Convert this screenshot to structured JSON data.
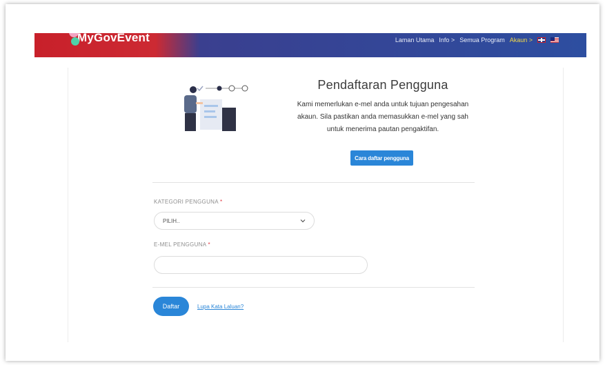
{
  "colors": {
    "primary": "#2a86d8",
    "nav_red": "#c8202a",
    "nav_blue": "#2d4ea0",
    "required": "#e0343f"
  },
  "navbar": {
    "logo": "MyGovEvent",
    "links": [
      {
        "label": "Laman Utama"
      },
      {
        "label": "Info >"
      },
      {
        "label": "Semua Program"
      },
      {
        "label": "Akaun >"
      }
    ],
    "flags": [
      "uk-flag-icon",
      "malaysia-flag-icon"
    ]
  },
  "intro": {
    "title": "Pendaftaran Pengguna",
    "description": "Kami memerlukan e-mel anda untuk tujuan pengesahan akaun. Sila pastikan anda memasukkan e-mel yang sah untuk menerima pautan pengaktifan.",
    "guide_button": "Cara daftar pengguna"
  },
  "form": {
    "category_label": "KATEGORI PENGGUNA",
    "category_value": "PILIH..",
    "email_label": "E-MEL PENGGUNA",
    "email_value": "",
    "required_mark": "*",
    "submit_label": "Daftar",
    "forgot_link": "Lupa Kata Laluan?"
  },
  "stepper": {
    "steps": [
      "done",
      "current",
      "pending",
      "pending"
    ]
  }
}
